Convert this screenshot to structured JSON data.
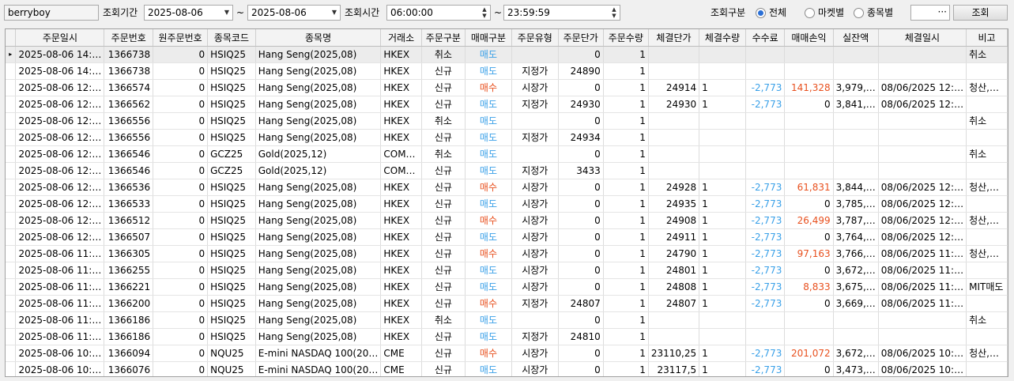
{
  "toolbar": {
    "user": "berryboy",
    "period_label": "조회기간",
    "date_from": "2025-08-06",
    "tilde": "~",
    "date_to": "2025-08-06",
    "time_label": "조회시간",
    "time_from": "06:00:00",
    "time_to": "23:59:59",
    "category_label": "조회구분",
    "radio_all": "전체",
    "radio_market": "마켓별",
    "radio_symbol": "종목별",
    "search_value": "",
    "ellipsis": "···",
    "query_label": "조회"
  },
  "grid": {
    "headers": [
      "주문일시",
      "주문번호",
      "원주문번호",
      "종목코드",
      "종목명",
      "거래소",
      "주문구분",
      "매매구분",
      "주문유형",
      "주문단가",
      "주문수량",
      "체결단가",
      "체결수량",
      "수수료",
      "매매손익",
      "실잔액",
      "체결일시",
      "비고"
    ],
    "rows": [
      [
        "2025-08-06 14:…",
        "1366738",
        "0",
        "HSIQ25",
        "Hang Seng(2025,08)",
        "HKEX",
        "취소",
        "매도",
        "",
        "0",
        "1",
        "",
        "",
        "",
        "",
        "",
        "",
        "취소"
      ],
      [
        "2025-08-06 14:…",
        "1366738",
        "0",
        "HSIQ25",
        "Hang Seng(2025,08)",
        "HKEX",
        "신규",
        "매도",
        "지정가",
        "24890",
        "1",
        "",
        "",
        "",
        "",
        "",
        "",
        ""
      ],
      [
        "2025-08-06 12:…",
        "1366574",
        "0",
        "HSIQ25",
        "Hang Seng(2025,08)",
        "HKEX",
        "신규",
        "매수",
        "시장가",
        "0",
        "1",
        "24914",
        "1",
        "-2,773",
        "141,328",
        "3,979,…",
        "08/06/2025 12:…",
        "청산,…"
      ],
      [
        "2025-08-06 12:…",
        "1366562",
        "0",
        "HSIQ25",
        "Hang Seng(2025,08)",
        "HKEX",
        "신규",
        "매도",
        "지정가",
        "24930",
        "1",
        "24930",
        "1",
        "-2,773",
        "0",
        "3,841,…",
        "08/06/2025 12:…",
        ""
      ],
      [
        "2025-08-06 12:…",
        "1366556",
        "0",
        "HSIQ25",
        "Hang Seng(2025,08)",
        "HKEX",
        "취소",
        "매도",
        "",
        "0",
        "1",
        "",
        "",
        "",
        "",
        "",
        "",
        "취소"
      ],
      [
        "2025-08-06 12:…",
        "1366556",
        "0",
        "HSIQ25",
        "Hang Seng(2025,08)",
        "HKEX",
        "신규",
        "매도",
        "지정가",
        "24934",
        "1",
        "",
        "",
        "",
        "",
        "",
        "",
        ""
      ],
      [
        "2025-08-06 12:…",
        "1366546",
        "0",
        "GCZ25",
        "Gold(2025,12)",
        "COM…",
        "취소",
        "매도",
        "",
        "0",
        "1",
        "",
        "",
        "",
        "",
        "",
        "",
        "취소"
      ],
      [
        "2025-08-06 12:…",
        "1366546",
        "0",
        "GCZ25",
        "Gold(2025,12)",
        "COM…",
        "신규",
        "매도",
        "지정가",
        "3433",
        "1",
        "",
        "",
        "",
        "",
        "",
        "",
        ""
      ],
      [
        "2025-08-06 12:…",
        "1366536",
        "0",
        "HSIQ25",
        "Hang Seng(2025,08)",
        "HKEX",
        "신규",
        "매수",
        "시장가",
        "0",
        "1",
        "24928",
        "1",
        "-2,773",
        "61,831",
        "3,844,…",
        "08/06/2025 12:…",
        "청산,…"
      ],
      [
        "2025-08-06 12:…",
        "1366533",
        "0",
        "HSIQ25",
        "Hang Seng(2025,08)",
        "HKEX",
        "신규",
        "매도",
        "시장가",
        "0",
        "1",
        "24935",
        "1",
        "-2,773",
        "0",
        "3,785,…",
        "08/06/2025 12:…",
        ""
      ],
      [
        "2025-08-06 12:…",
        "1366512",
        "0",
        "HSIQ25",
        "Hang Seng(2025,08)",
        "HKEX",
        "신규",
        "매수",
        "시장가",
        "0",
        "1",
        "24908",
        "1",
        "-2,773",
        "26,499",
        "3,787,…",
        "08/06/2025 12:…",
        "청산,…"
      ],
      [
        "2025-08-06 12:…",
        "1366507",
        "0",
        "HSIQ25",
        "Hang Seng(2025,08)",
        "HKEX",
        "신규",
        "매도",
        "시장가",
        "0",
        "1",
        "24911",
        "1",
        "-2,773",
        "0",
        "3,764,…",
        "08/06/2025 12:…",
        ""
      ],
      [
        "2025-08-06 11:…",
        "1366305",
        "0",
        "HSIQ25",
        "Hang Seng(2025,08)",
        "HKEX",
        "신규",
        "매수",
        "시장가",
        "0",
        "1",
        "24790",
        "1",
        "-2,773",
        "97,163",
        "3,766,…",
        "08/06/2025 11:…",
        "청산,…"
      ],
      [
        "2025-08-06 11:…",
        "1366255",
        "0",
        "HSIQ25",
        "Hang Seng(2025,08)",
        "HKEX",
        "신규",
        "매도",
        "시장가",
        "0",
        "1",
        "24801",
        "1",
        "-2,773",
        "0",
        "3,672,…",
        "08/06/2025 11:…",
        ""
      ],
      [
        "2025-08-06 11:…",
        "1366221",
        "0",
        "HSIQ25",
        "Hang Seng(2025,08)",
        "HKEX",
        "신규",
        "매도",
        "시장가",
        "0",
        "1",
        "24808",
        "1",
        "-2,773",
        "8,833",
        "3,675,…",
        "08/06/2025 11:…",
        "MIT매도"
      ],
      [
        "2025-08-06 11:…",
        "1366200",
        "0",
        "HSIQ25",
        "Hang Seng(2025,08)",
        "HKEX",
        "신규",
        "매수",
        "지정가",
        "24807",
        "1",
        "24807",
        "1",
        "-2,773",
        "0",
        "3,669,…",
        "08/06/2025 11:…",
        ""
      ],
      [
        "2025-08-06 11:…",
        "1366186",
        "0",
        "HSIQ25",
        "Hang Seng(2025,08)",
        "HKEX",
        "취소",
        "매도",
        "",
        "0",
        "1",
        "",
        "",
        "",
        "",
        "",
        "",
        "취소"
      ],
      [
        "2025-08-06 11:…",
        "1366186",
        "0",
        "HSIQ25",
        "Hang Seng(2025,08)",
        "HKEX",
        "신규",
        "매도",
        "지정가",
        "24810",
        "1",
        "",
        "",
        "",
        "",
        "",
        "",
        ""
      ],
      [
        "2025-08-06 10:…",
        "1366094",
        "0",
        "NQU25",
        "E-mini NASDAQ 100(20…",
        "CME",
        "신규",
        "매수",
        "시장가",
        "0",
        "1",
        "23110,25",
        "1",
        "-2,773",
        "201,072",
        "3,672,…",
        "08/06/2025 10:…",
        "청산,…"
      ],
      [
        "2025-08-06 10:…",
        "1366076",
        "0",
        "NQU25",
        "E-mini NASDAQ 100(20…",
        "CME",
        "신규",
        "매도",
        "시장가",
        "0",
        "1",
        "23117,5",
        "1",
        "-2,773",
        "0",
        "3,473,…",
        "08/06/2025 10:…",
        ""
      ]
    ],
    "selected_row": 0,
    "row_indicator": "▸"
  },
  "colors": {
    "buy": "#e8501e",
    "sell": "#39a0e8",
    "profit": "#e8501e",
    "fee": "#39a0e8"
  }
}
